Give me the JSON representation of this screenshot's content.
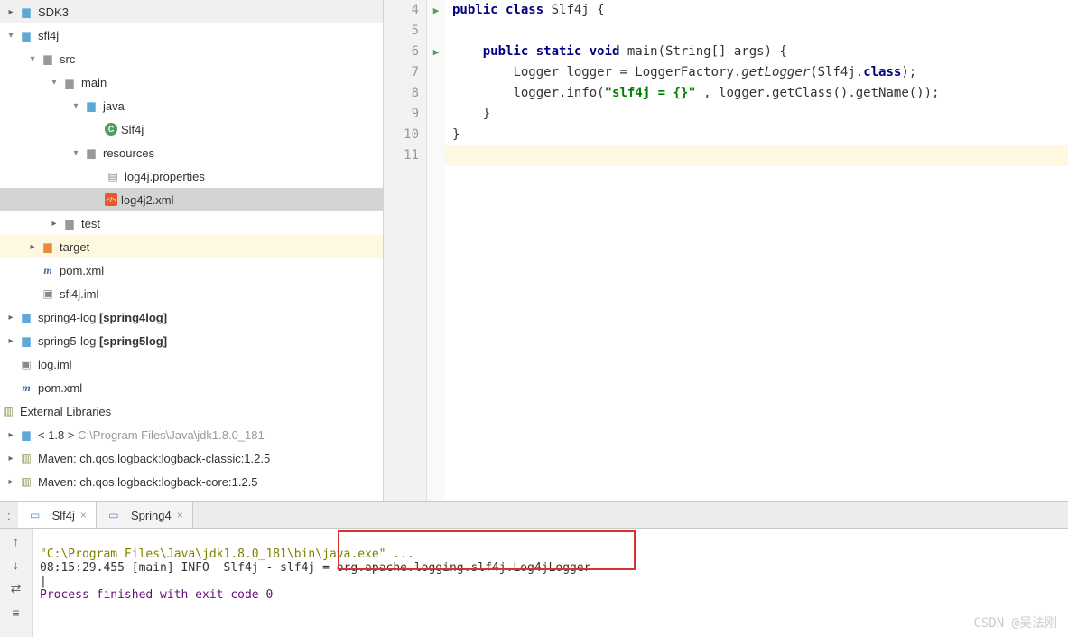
{
  "tree": {
    "sdk3": "SDK3",
    "sfl4j": "sfl4j",
    "src": "src",
    "main": "main",
    "java": "java",
    "slf4j_class": "Slf4j",
    "resources": "resources",
    "log4j_props": "log4j.properties",
    "log4j2_xml": "log4j2.xml",
    "test": "test",
    "target": "target",
    "pom1": "pom.xml",
    "sfl4j_iml": "sfl4j.iml",
    "spring4log": "spring4-log",
    "spring4log_b": "[spring4log]",
    "spring5log": "spring5-log",
    "spring5log_b": "[spring5log]",
    "log_iml": "log.iml",
    "pom2": "pom.xml",
    "ext_libs": "External Libraries",
    "jdk": "< 1.8 >",
    "jdk_path": " C:\\Program Files\\Java\\jdk1.8.0_181",
    "maven1": "Maven: ch.qos.logback:logback-classic:1.2.5",
    "maven2": "Maven: ch.qos.logback:logback-core:1.2.5"
  },
  "code": {
    "line_numbers": [
      "4",
      "5",
      "6",
      "7",
      "8",
      "9",
      "10",
      "11"
    ],
    "l4": {
      "kw1": "public class",
      "name": " Slf4j {"
    },
    "l6": {
      "kw1": "public static void",
      "name": " main(String[] args) {"
    },
    "l7_a": "Logger logger = LoggerFactory.",
    "l7_m": "getLogger",
    "l7_b": "(Slf4j.",
    "l7_kw": "class",
    "l7_c": ");",
    "l8_a": "logger.info(",
    "l8_s": "\"slf4j = {}\"",
    "l8_b": " , logger.getClass().getName());",
    "l9": "}",
    "l10": "}"
  },
  "tabs": {
    "t1": "Slf4j",
    "t2": "Spring4"
  },
  "console": {
    "cmd": "\"C:\\Program Files\\Java\\jdk1.8.0_181\\bin\\java.exe\" ...",
    "log_a": "08:15:29.455 [main] INFO  Slf4j - slf4j = ",
    "log_b": "org.apache.logging.slf4j.Log4jLogger",
    "exit": "Process finished with exit code 0"
  },
  "watermark": "CSDN @吴法刚"
}
